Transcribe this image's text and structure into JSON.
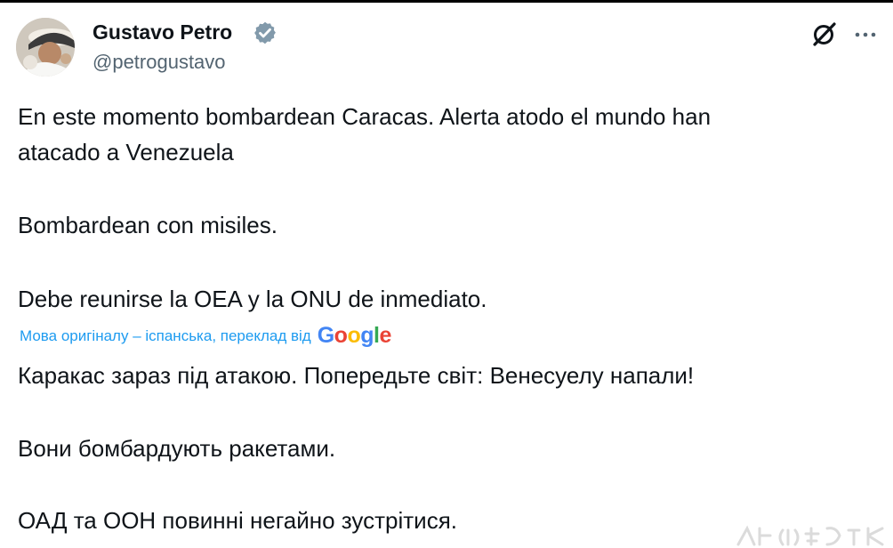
{
  "tweet": {
    "author": {
      "display_name": "Gustavo Petro",
      "handle": "@petrogustavo",
      "verified": true
    },
    "header_icons": {
      "grok": "grok-icon",
      "more": "more-dots-icon"
    },
    "original_paragraphs": [
      "En este momento bombardean Caracas. Alerta atodo el mundo han",
      "atacado a Venezuela",
      "Bombardean con misiles.",
      "Debe reunirse la OEA y la ONU de inmediato."
    ],
    "translation": {
      "note": "Мова оригіналу – іспанська, переклад від",
      "provider": [
        "G",
        "o",
        "o",
        "g",
        "l",
        "e"
      ],
      "provider_colors": [
        "#4285F4",
        "#EA4335",
        "#FBBC05",
        "#4285F4",
        "#34A853",
        "#EA4335"
      ],
      "paragraphs": [
        "Каракас зараз під атакою. Попередьте світ: Венесуелу напали!",
        "Вони бомбардують ракетами.",
        "ОАД та ООН повинні негайно зустрітися."
      ]
    },
    "colors": {
      "text": "#0f1419",
      "secondary": "#536471",
      "link": "#1d9bf0",
      "verified": "#829aab"
    }
  }
}
